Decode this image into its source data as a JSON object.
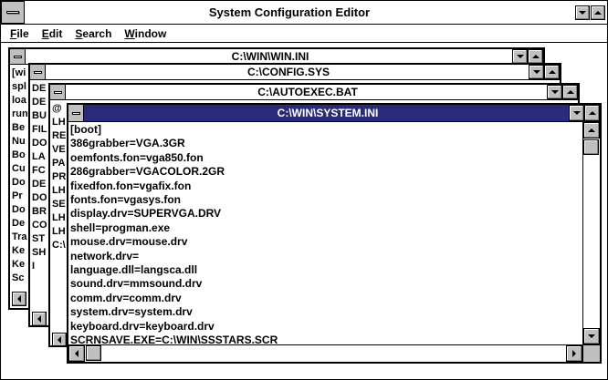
{
  "app": {
    "title": "System Configuration Editor"
  },
  "menu": [
    "File",
    "Edit",
    "Search",
    "Window"
  ],
  "colors": {
    "active_title_bg": "#2a2a7a",
    "app_title_bg": "#ffffff",
    "button_face": "#c0c0c0"
  },
  "windows": {
    "win_ini": {
      "title": "C:\\WIN\\WIN.INI",
      "visible_lines": [
        "[wi",
        "spl",
        "loa",
        "run",
        "Be",
        "Nu",
        "Bo",
        "Cu",
        "Do",
        "Pr",
        "Do",
        "De",
        "Tra",
        "Ke",
        "Ke",
        "Sc"
      ]
    },
    "config_sys": {
      "title": "C:\\CONFIG.SYS",
      "visible_lines": [
        "DE",
        "DE",
        "BU",
        "FIL",
        "DO",
        "LA",
        "FC",
        "DE",
        "DO",
        "BR",
        "CO",
        "ST",
        "SH",
        "I"
      ]
    },
    "autoexec_bat": {
      "title": "C:\\AUTOEXEC.BAT",
      "visible_lines": [
        "@",
        "LH",
        "RE",
        "VE",
        "PA",
        "PR",
        "LH",
        "SE",
        "LH",
        "LH",
        "C:\\"
      ]
    },
    "system_ini": {
      "title": "C:\\WIN\\SYSTEM.INI",
      "lines": [
        "[boot]",
        "386grabber=VGA.3GR",
        "oemfonts.fon=vga850.fon",
        "286grabber=VGACOLOR.2GR",
        "fixedfon.fon=vgafix.fon",
        "fonts.fon=vgasys.fon",
        "display.drv=SUPERVGA.DRV",
        "shell=progman.exe",
        "mouse.drv=mouse.drv",
        "network.drv=",
        "language.dll=langsca.dll",
        "sound.drv=mmsound.drv",
        "comm.drv=comm.drv",
        "system.drv=system.drv",
        "keyboard.drv=keyboard.drv",
        "SCRNSAVE.EXE=C:\\WIN\\SSSTARS.SCR"
      ]
    }
  }
}
